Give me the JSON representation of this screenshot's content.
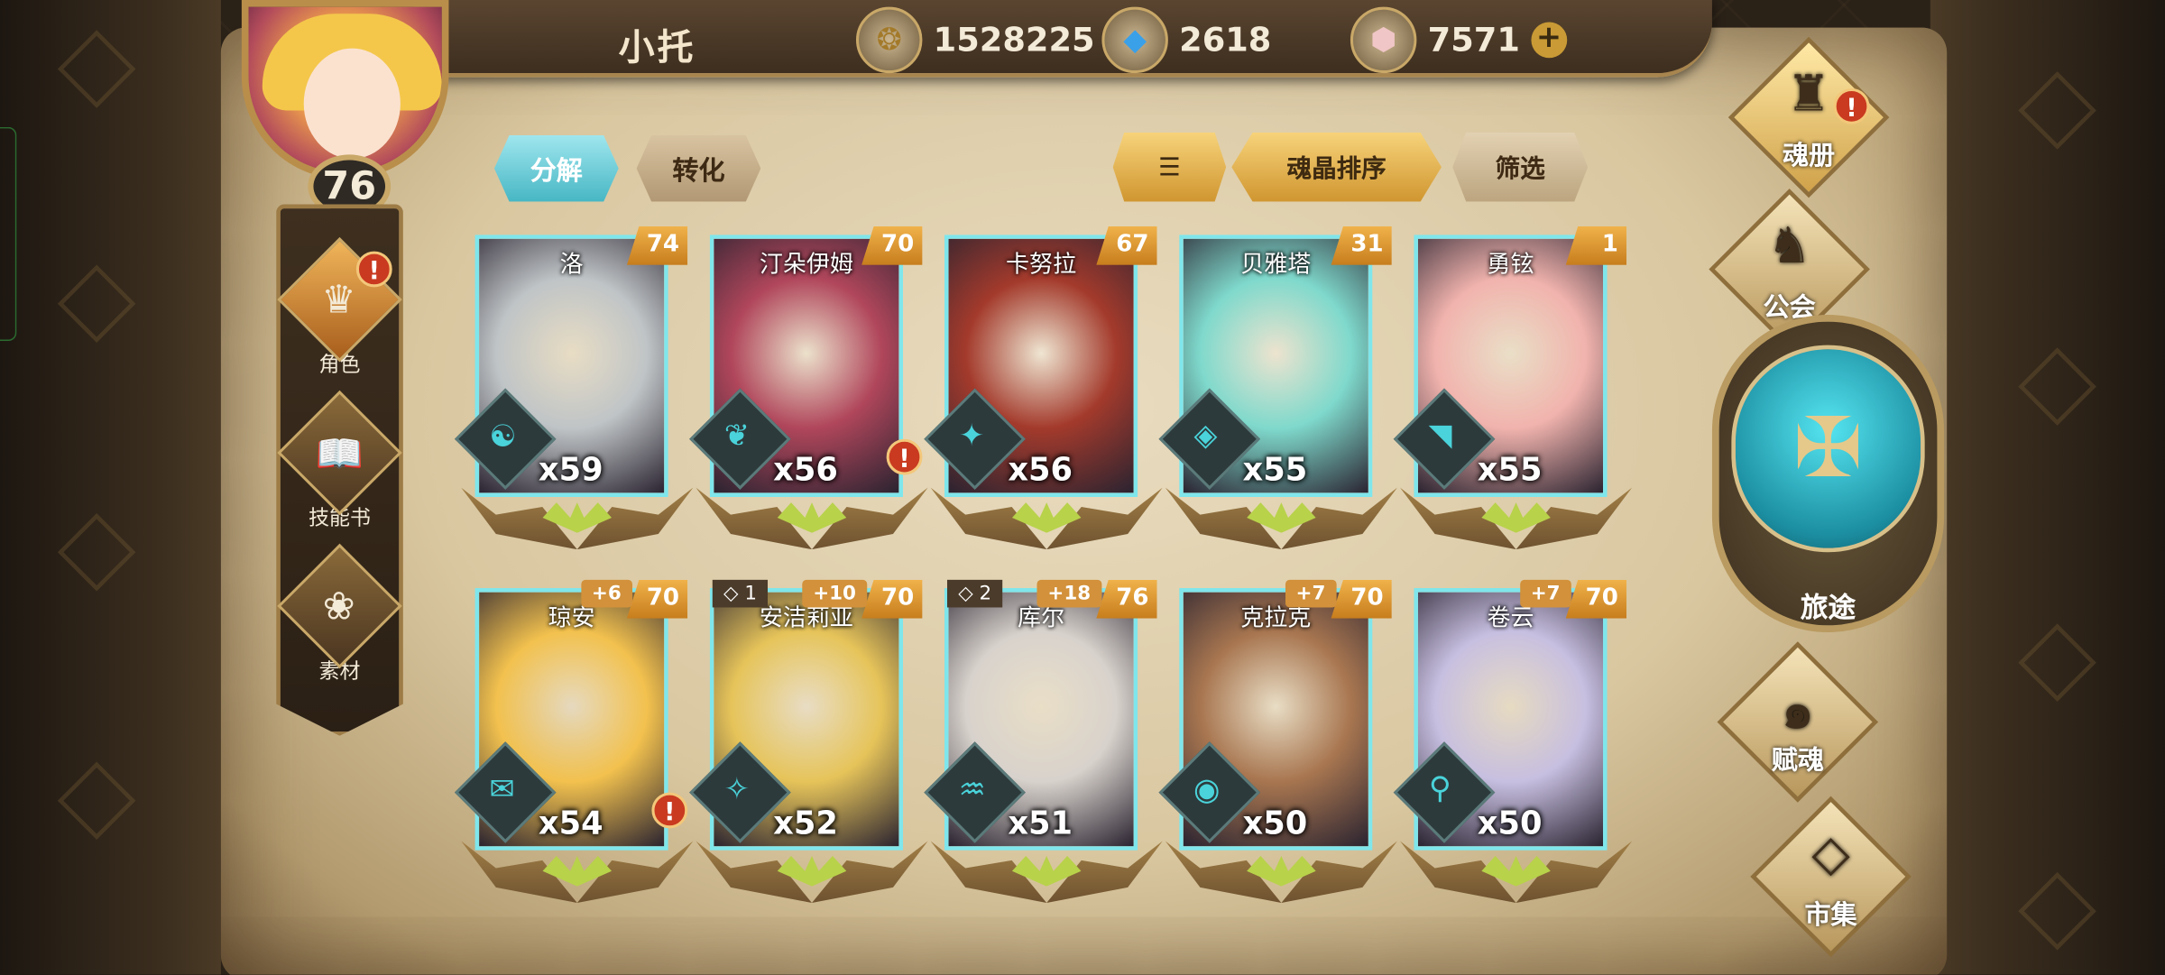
{
  "player": {
    "name": "小托",
    "level": "76"
  },
  "currencies": [
    {
      "icon": "gold-coin-icon",
      "value": "1528225"
    },
    {
      "icon": "blue-crystal-icon",
      "value": "2618"
    },
    {
      "icon": "pink-crystal-icon",
      "value": "7571",
      "plus": "+"
    }
  ],
  "left_nav": [
    {
      "label": "角色",
      "icon": "character-icon",
      "alert": "!"
    },
    {
      "label": "技能书",
      "icon": "skill-book-icon"
    },
    {
      "label": "素材",
      "icon": "material-icon"
    }
  ],
  "tabs": {
    "decompose": "分解",
    "convert": "转化"
  },
  "sort": {
    "sort_icon": "sort-icon",
    "sort_label": "魂晶排序",
    "filter_label": "筛选"
  },
  "cards": [
    {
      "name": "洛",
      "level": "74",
      "count": "x59",
      "elem": "☯",
      "art": "#bfc4c6"
    },
    {
      "name": "汀朵伊姆",
      "level": "70",
      "count": "x56",
      "elem": "❦",
      "alert": "!",
      "art": "#b0465b"
    },
    {
      "name": "卡努拉",
      "level": "67",
      "count": "x56",
      "elem": "✦",
      "art": "#a33a2c"
    },
    {
      "name": "贝雅塔",
      "level": "31",
      "count": "x55",
      "elem": "◈",
      "art": "#7fd9cc"
    },
    {
      "name": "勇铉",
      "level": "1",
      "count": "x55",
      "elem": "◥",
      "art": "#f1b3ad"
    },
    {
      "name": "琼安",
      "level": "70",
      "plus": "+6",
      "count": "x54",
      "elem": "✉",
      "alert": "!",
      "art": "#f2c14e"
    },
    {
      "name": "安洁莉亚",
      "level": "70",
      "plus": "+10",
      "star": "◇ 1",
      "count": "x52",
      "elem": "✧",
      "art": "#e6c45a"
    },
    {
      "name": "库尔",
      "level": "76",
      "plus": "+18",
      "star": "◇ 2",
      "count": "x51",
      "elem": "♒",
      "art": "#d8d2cc"
    },
    {
      "name": "克拉克",
      "level": "70",
      "plus": "+7",
      "count": "x50",
      "elem": "◉",
      "art": "#a87650"
    },
    {
      "name": "卷云",
      "level": "70",
      "plus": "+7",
      "count": "x50",
      "elem": "⚲",
      "art": "#c7bfe0"
    }
  ],
  "right_nav": [
    {
      "label": "魂册",
      "icon": "soul-book-icon",
      "alert": "!"
    },
    {
      "label": "公会",
      "icon": "guild-icon"
    },
    {
      "label": "旅途",
      "icon": "journey-icon"
    },
    {
      "label": "赋魂",
      "icon": "soul-enchant-icon"
    },
    {
      "label": "市集",
      "icon": "market-icon"
    }
  ]
}
